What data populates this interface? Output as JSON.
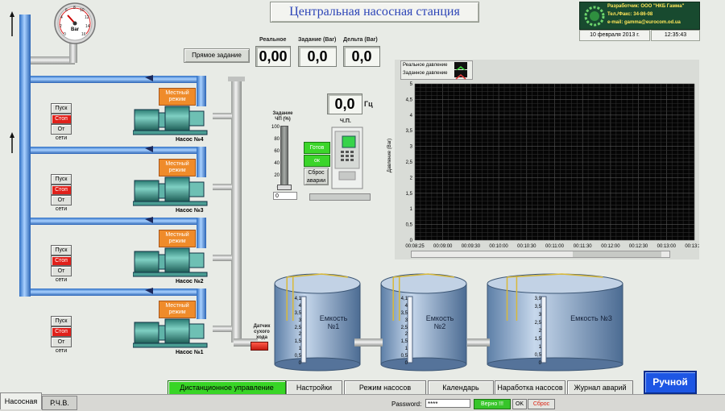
{
  "title": "Центральная насосная станция",
  "developer": {
    "line1": "Разработчик: ООО \"НКБ Гамма\"",
    "line2": "Тел./Факс: 34-86-08",
    "line3": "e-mail: gamma@eurocom.od.ua",
    "date": "10 февраля 2013 г.",
    "time": "12:35:43"
  },
  "gauge": {
    "unit": "Bar",
    "ticks": [
      "0",
      "2",
      "4",
      "6",
      "8",
      "10",
      "12",
      "14",
      "16"
    ]
  },
  "readouts": {
    "direct_task_label": "Прямое задание",
    "real_label": "Реальное",
    "real_value": "0,00",
    "task_label": "Задание (Bar)",
    "task_value": "0,0",
    "delta_label": "Дельта (Bar)",
    "delta_value": "0,0",
    "freq_value": "0,0",
    "freq_unit": "Гц"
  },
  "vfd": {
    "task_label": "Задание ЧП (%)",
    "slider_ticks": [
      "100",
      "80",
      "60",
      "40",
      "20",
      "0"
    ],
    "slider_value": "0",
    "vfd_label": "Ч.П.",
    "ready": "Готов",
    "ok": "ок",
    "reset": "Сброс аварии"
  },
  "sensor": {
    "label": "Датчик сухого хода"
  },
  "pumps": [
    {
      "name": "Насос №4",
      "mode": "Местный режим",
      "start": "Пуск",
      "stop": "Стоп",
      "net": "От сети"
    },
    {
      "name": "Насос №3",
      "mode": "Местный режим",
      "start": "Пуск",
      "stop": "Стоп",
      "net": "От сети"
    },
    {
      "name": "Насос №2",
      "mode": "Местный режим",
      "start": "Пуск",
      "stop": "Стоп",
      "net": "От сети"
    },
    {
      "name": "Насос №1",
      "mode": "Местный режим",
      "start": "Пуск",
      "stop": "Стоп",
      "net": "От сети"
    }
  ],
  "chart_data": {
    "type": "line",
    "legend": [
      "Реальное давление",
      "Заданное давление"
    ],
    "ylabel": "Давление (Bar)",
    "yticks": [
      "5",
      "4,5",
      "4",
      "3,5",
      "3",
      "2,5",
      "2",
      "1,5",
      "1",
      "0,5",
      "0"
    ],
    "xticks": [
      "00:08:25",
      "00:09:00",
      "00:09:30",
      "00:10:00",
      "00:10:30",
      "00:11:00",
      "00:11:30",
      "00:12:00",
      "00:12:30",
      "00:13:00",
      "00:13:25"
    ],
    "ylim": [
      0,
      5
    ],
    "series": [],
    "colors": {
      "real": "#3bd33b",
      "task": "#e03a3a"
    }
  },
  "tanks": [
    {
      "name": "Емкость №1",
      "ticks": [
        "4,1",
        "4",
        "3,5",
        "3",
        "2,5",
        "2",
        "1,5",
        "1",
        "0,5",
        "0"
      ]
    },
    {
      "name": "Емкость №2",
      "ticks": [
        "4,1",
        "4",
        "3,5",
        "3",
        "2,5",
        "2",
        "1,5",
        "1",
        "0,5",
        "0"
      ]
    },
    {
      "name": "Емкость №3",
      "ticks": [
        "3,9",
        "3,5",
        "3",
        "2,5",
        "2",
        "1,5",
        "1",
        "0,5",
        "0"
      ]
    }
  ],
  "nav": [
    {
      "label": "Дистанционное управление"
    },
    {
      "label": "Настройки"
    },
    {
      "label": "Режим насосов"
    },
    {
      "label": "Календарь"
    },
    {
      "label": "Наработка насосов"
    },
    {
      "label": "Журнал аварий"
    }
  ],
  "manual_button": "Ручной",
  "tabs": [
    "Насосная",
    "Р.Ч.В."
  ],
  "password": {
    "label": "Password:",
    "value": "****",
    "status": "Верно !!!",
    "ok": "OK",
    "reset": "Сброс"
  }
}
